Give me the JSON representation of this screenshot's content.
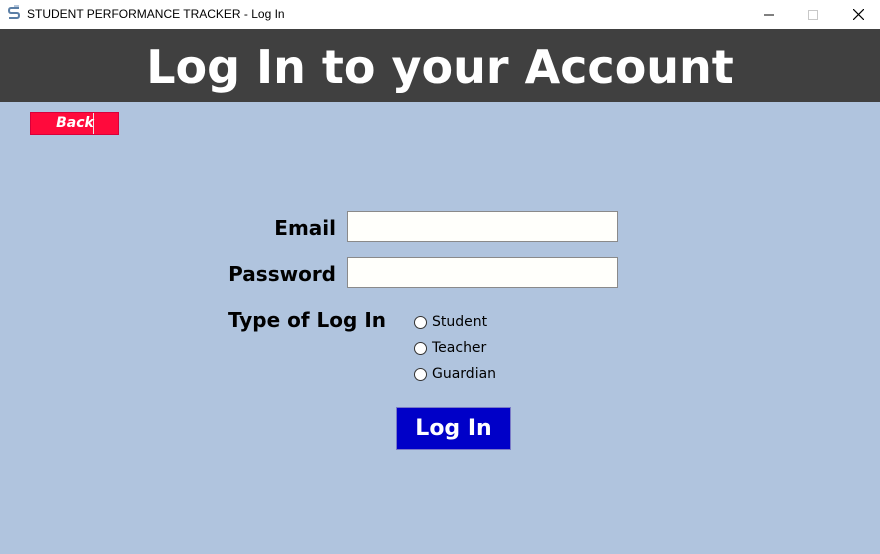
{
  "window": {
    "title": "STUDENT PERFORMANCE TRACKER - Log In",
    "app_icon": "app-s-logo-icon",
    "controls": [
      "minimize-icon",
      "maximize-icon",
      "close-icon"
    ]
  },
  "header": {
    "title": "Log In to your Account",
    "background": "#404040"
  },
  "back_button": {
    "label": "Back",
    "color": "#ff0a3c"
  },
  "form": {
    "email_label": "Email",
    "email_value": "",
    "password_label": "Password",
    "password_value": "",
    "login_type_label": "Type of Log In",
    "login_types": [
      "Student",
      "Teacher",
      "Guardian"
    ],
    "selected_login_type": null,
    "submit_label": "Log In",
    "submit_color": "#0000c8"
  },
  "colors": {
    "page_background": "#b0c4de"
  }
}
